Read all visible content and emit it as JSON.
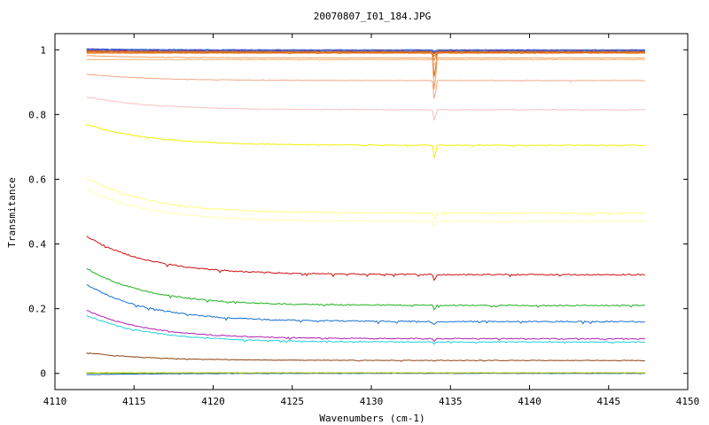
{
  "chart_data": {
    "type": "line",
    "title": "20070807_I01_184.JPG",
    "xlabel": "Wavenumbers (cm-1)",
    "ylabel": "Transmitance",
    "xlim": [
      4110,
      4150
    ],
    "ylim": [
      -0.05,
      1.05
    ],
    "x_ticks": [
      "4110",
      "4115",
      "4120",
      "4125",
      "4130",
      "4135",
      "4140",
      "4145",
      "4150"
    ],
    "y_ticks": [
      "0",
      "0.2",
      "0.4",
      "0.6",
      "0.8",
      "1"
    ],
    "x_start": 4112,
    "x_end": 4147.3,
    "absorption_line": 4134.0,
    "grid": false,
    "legend": "none",
    "series": [
      {
        "color": "#2050c0",
        "start": 1.003,
        "end": 1.0,
        "dip": 0.005
      },
      {
        "color": "#7030a0",
        "start": 1.001,
        "end": 0.998,
        "dip": 0.006
      },
      {
        "color": "#40a0ff",
        "start": 0.999,
        "end": 0.997,
        "dip": 0.007
      },
      {
        "color": "#c02020",
        "start": 0.997,
        "end": 0.995,
        "dip": 0.008
      },
      {
        "color": "#d07010",
        "start": 0.995,
        "end": 0.993,
        "dip": 0.015
      },
      {
        "color": "#e09030",
        "start": 0.993,
        "end": 0.992,
        "dip": 0.03
      },
      {
        "color": "#e06000",
        "start": 0.99,
        "end": 0.99,
        "dip": 0.09
      },
      {
        "color": "#f0a060",
        "start": 0.982,
        "end": 0.975,
        "dip": 0.12
      },
      {
        "color": "#f4b070",
        "start": 0.97,
        "end": 0.97,
        "dip": 0.02
      },
      {
        "color": "#f0a888",
        "start": 0.925,
        "end": 0.905,
        "dip": 0.07
      },
      {
        "color": "#f8c0c0",
        "start": 0.855,
        "end": 0.815,
        "dip": 0.04
      },
      {
        "color": "#f0f000",
        "start": 0.77,
        "end": 0.705,
        "dip": 0.05
      },
      {
        "color": "#ffff80",
        "start": 0.605,
        "end": 0.495,
        "dip": 0.02
      },
      {
        "color": "#ffffb0",
        "start": 0.57,
        "end": 0.47,
        "dip": 0.02
      },
      {
        "color": "#d01010",
        "start": 0.425,
        "end": 0.305,
        "dip": 0.02
      },
      {
        "color": "#20b020",
        "start": 0.325,
        "end": 0.21,
        "dip": 0.015
      },
      {
        "color": "#1870d0",
        "start": 0.275,
        "end": 0.16,
        "dip": 0.01
      },
      {
        "color": "#b020b0",
        "start": 0.195,
        "end": 0.107,
        "dip": 0.008
      },
      {
        "color": "#20d0e0",
        "start": 0.18,
        "end": 0.097,
        "dip": 0.008
      },
      {
        "color": "#904010",
        "start": 0.064,
        "end": 0.04,
        "dip": 0.003
      },
      {
        "color": "#00a000",
        "start": 0.001,
        "end": 0.001,
        "dip": 0.0
      },
      {
        "color": "#2060b0",
        "start": -0.004,
        "end": 0.0,
        "dip": 0.0
      },
      {
        "color": "#d0d000",
        "start": 0.002,
        "end": 0.002,
        "dip": 0.0
      }
    ]
  }
}
